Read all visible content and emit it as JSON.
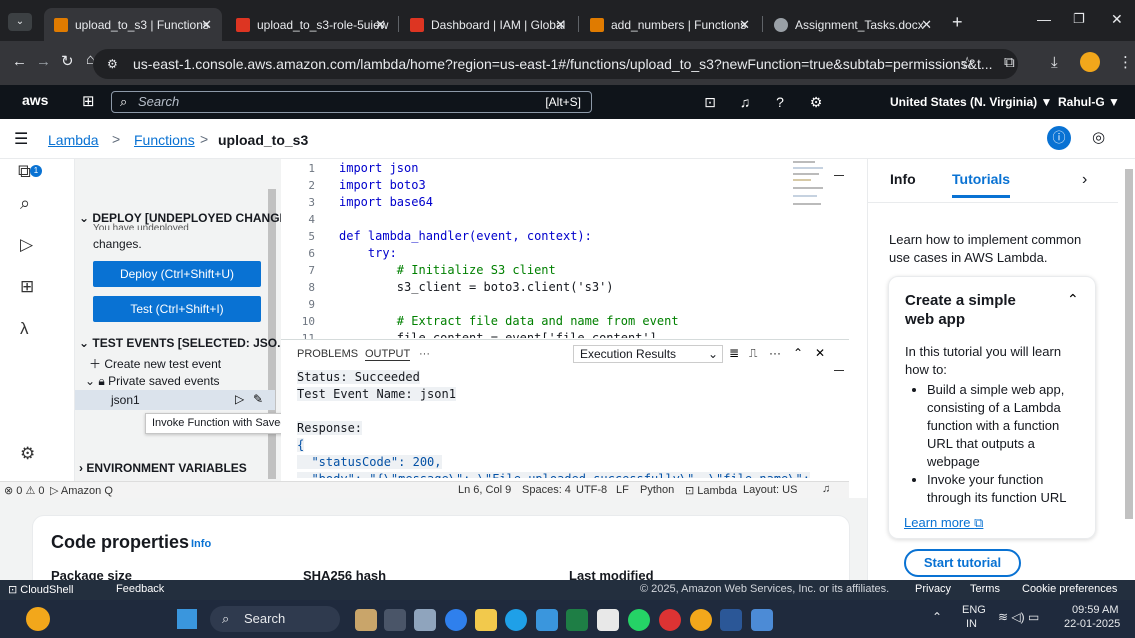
{
  "browser": {
    "tabs": [
      {
        "label": "upload_to_s3 | Functions",
        "color": "#e07b00",
        "active": true
      },
      {
        "label": "upload_to_s3-role-5uiew",
        "color": "#dd3522",
        "active": false
      },
      {
        "label": "Dashboard | IAM | Global",
        "color": "#dd3522",
        "active": false
      },
      {
        "label": "add_numbers | Functions",
        "color": "#e07b00",
        "active": false
      },
      {
        "label": "Assignment_Tasks.docx",
        "color": "#9aa0a6",
        "active": false
      }
    ],
    "new_tab": "+",
    "url": "us-east-1.console.aws.amazon.com/lambda/home?region=us-east-1#/functions/upload_to_s3?newFunction=true&subtab=permissions&t..."
  },
  "aws": {
    "logo": "aws",
    "search_placeholder": "Search",
    "search_shortcut": "[Alt+S]",
    "region": "United States (N. Virginia) ▼",
    "user": "Rahul-G ▼"
  },
  "breadcrumb": {
    "items": [
      "Lambda",
      "Functions",
      "upload_to_s3"
    ]
  },
  "sidebar": {
    "deploy_header": "DEPLOY [UNDEPLOYED CHANGES]",
    "undeployed_partial": "You have undeployed",
    "changes": "changes.",
    "deploy_button": "Deploy (Ctrl+Shift+U)",
    "test_button": "Test (Ctrl+Shift+I)",
    "test_events_header": "TEST EVENTS [SELECTED: JSO...",
    "create_event": "Create new test event",
    "private_events": "Private saved events",
    "event_name": "json1",
    "tooltip": "Invoke Function with Saved Test Event",
    "env_header": "ENVIRONMENT VARIABLES",
    "rail_badge": "1"
  },
  "editor": {
    "lines": [
      {
        "n": "1",
        "code": "import json"
      },
      {
        "n": "2",
        "code": "import boto3"
      },
      {
        "n": "3",
        "code": "import base64"
      },
      {
        "n": "4",
        "code": ""
      },
      {
        "n": "5",
        "code": "def lambda_handler(event, context):"
      },
      {
        "n": "6",
        "code": "    try:"
      },
      {
        "n": "7",
        "code": "        # Initialize S3 client"
      },
      {
        "n": "8",
        "code": "        s3_client = boto3.client('s3')"
      },
      {
        "n": "9",
        "code": ""
      },
      {
        "n": "10",
        "code": "        # Extract file data and name from event"
      },
      {
        "n": "11",
        "code": "        file_content = event['file_content']"
      }
    ]
  },
  "panel": {
    "tabs": [
      "PROBLEMS",
      "OUTPUT",
      "···"
    ],
    "dropdown": "Execution Results",
    "output": [
      "Status: Succeeded",
      "Test Event Name: json1",
      "",
      "Response:",
      "{",
      "  \"statusCode\": 200,",
      "  \"body\": \"{\\\"message\\\": \\\"File uploaded successfully\\\", \\\"file_name\\\":"
    ]
  },
  "statusbar": {
    "problems": "⊗ 0 ⚠ 0",
    "amazonq": "▷ Amazon Q",
    "position": "Ln 6, Col 9",
    "spaces": "Spaces: 4",
    "encoding": "UTF-8",
    "eol": "LF",
    "language": "Python",
    "lambda": "Lambda",
    "layout": "Layout: US"
  },
  "code_properties": {
    "title": "Code properties",
    "info": "Info",
    "cols": [
      "Package size",
      "SHA256 hash",
      "Last modified"
    ]
  },
  "right": {
    "tabs": [
      "Info",
      "Tutorials"
    ],
    "intro": "Learn how to implement common use cases in AWS Lambda.",
    "card_title": "Create a simple web app",
    "card_intro": "In this tutorial you will learn how to:",
    "bullets": [
      "Build a simple web app, consisting of a Lambda function with a function URL that outputs a webpage",
      "Invoke your function through its function URL"
    ],
    "learn_more": "Learn more",
    "start": "Start tutorial"
  },
  "footer": {
    "cloudshell": "CloudShell",
    "feedback": "Feedback",
    "copyright": "© 2025, Amazon Web Services, Inc. or its affiliates.",
    "privacy": "Privacy",
    "terms": "Terms",
    "cookies": "Cookie preferences"
  },
  "taskbar": {
    "search": "Search",
    "lang": "ENG",
    "lang2": "IN",
    "time": "09:59 AM",
    "date": "22-01-2025"
  }
}
